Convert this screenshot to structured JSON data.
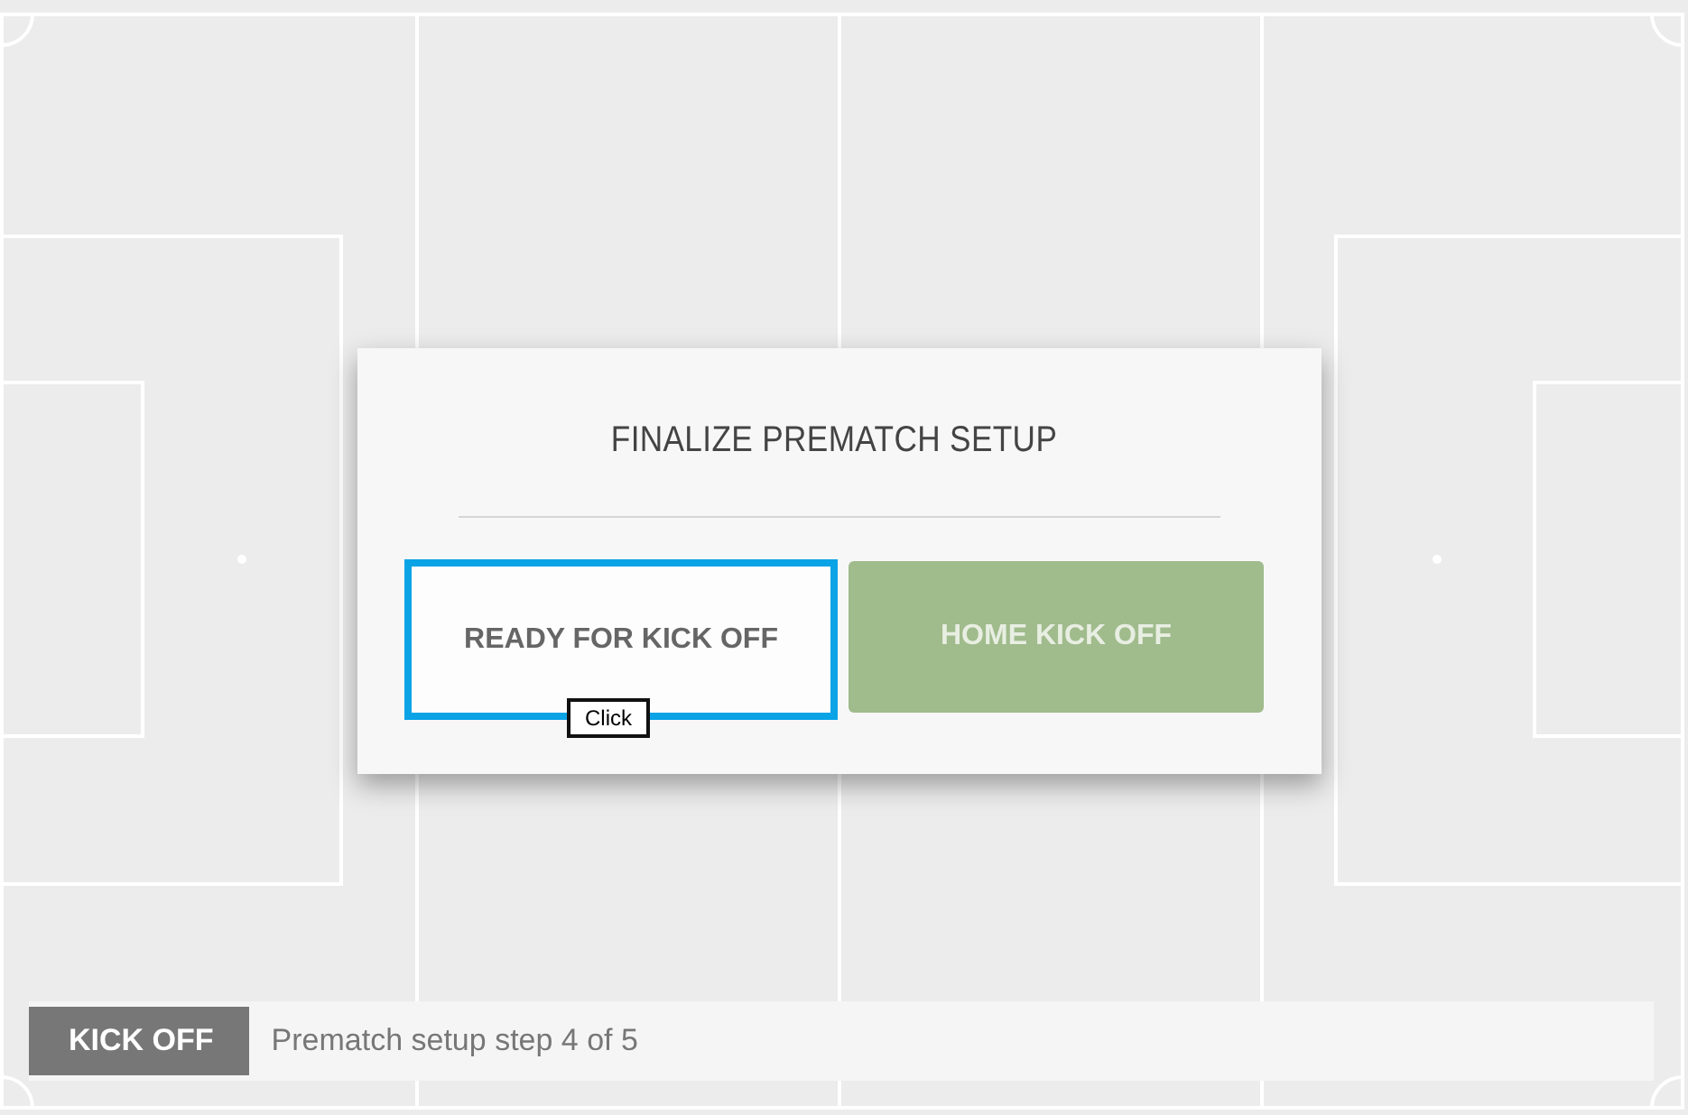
{
  "dialog": {
    "title": "FINALIZE PREMATCH SETUP",
    "buttons": [
      {
        "label": "READY FOR KICK OFF",
        "kind": "outline",
        "focused": true
      },
      {
        "label": "HOME KICK OFF",
        "kind": "filled",
        "focused": false
      }
    ],
    "tooltip": "Click"
  },
  "status_bar": {
    "badge": "KICK OFF",
    "text": "Prematch setup step 4 of 5"
  }
}
